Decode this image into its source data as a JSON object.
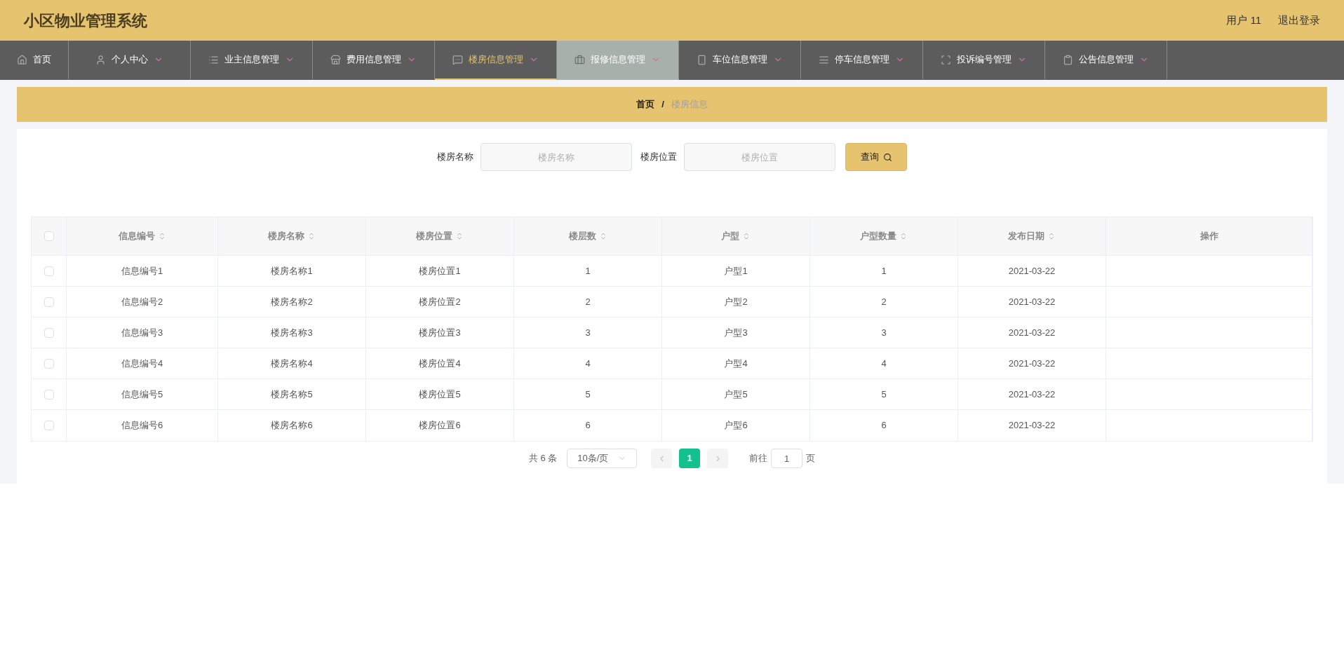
{
  "header": {
    "title": "小区物业管理系统",
    "user": "用户 11",
    "logout": "退出登录"
  },
  "nav": [
    {
      "label": "首页",
      "kind": "link",
      "selected": false,
      "hovered": false
    },
    {
      "label": "个人中心",
      "kind": "menu",
      "selected": false,
      "hovered": false
    },
    {
      "label": "业主信息管理",
      "kind": "menu",
      "selected": false,
      "hovered": false
    },
    {
      "label": "费用信息管理",
      "kind": "menu",
      "selected": false,
      "hovered": false
    },
    {
      "label": "楼房信息管理",
      "kind": "menu",
      "selected": true,
      "hovered": false
    },
    {
      "label": "报修信息管理",
      "kind": "menu",
      "selected": false,
      "hovered": true
    },
    {
      "label": "车位信息管理",
      "kind": "menu",
      "selected": false,
      "hovered": false
    },
    {
      "label": "停车信息管理",
      "kind": "menu",
      "selected": false,
      "hovered": false
    },
    {
      "label": "投诉编号管理",
      "kind": "menu",
      "selected": false,
      "hovered": false
    },
    {
      "label": "公告信息管理",
      "kind": "menu",
      "selected": false,
      "hovered": false
    }
  ],
  "breadcrumb": {
    "home": "首页",
    "separator": "/",
    "current": "楼房信息"
  },
  "search": {
    "fields": [
      {
        "label": "楼房名称",
        "placeholder": "楼房名称"
      },
      {
        "label": "楼房位置",
        "placeholder": "楼房位置"
      }
    ],
    "button": "查询"
  },
  "table": {
    "columns": [
      {
        "label": "信息编号",
        "kind": "sortable"
      },
      {
        "label": "楼房名称",
        "kind": "sortable"
      },
      {
        "label": "楼房位置",
        "kind": "sortable"
      },
      {
        "label": "楼层数",
        "kind": "sortable"
      },
      {
        "label": "户型",
        "kind": "sortable"
      },
      {
        "label": "户型数量",
        "kind": "sortable"
      },
      {
        "label": "发布日期",
        "kind": "sortable"
      },
      {
        "label": "操作",
        "kind": "plain"
      }
    ],
    "all_checked": false,
    "rows": [
      {
        "checked": false,
        "cells": [
          "信息编号1",
          "楼房名称1",
          "楼房位置1",
          "1",
          "户型1",
          "1",
          "2021-03-22",
          ""
        ]
      },
      {
        "checked": false,
        "cells": [
          "信息编号2",
          "楼房名称2",
          "楼房位置2",
          "2",
          "户型2",
          "2",
          "2021-03-22",
          ""
        ]
      },
      {
        "checked": false,
        "cells": [
          "信息编号3",
          "楼房名称3",
          "楼房位置3",
          "3",
          "户型3",
          "3",
          "2021-03-22",
          ""
        ]
      },
      {
        "checked": false,
        "cells": [
          "信息编号4",
          "楼房名称4",
          "楼房位置4",
          "4",
          "户型4",
          "4",
          "2021-03-22",
          ""
        ]
      },
      {
        "checked": false,
        "cells": [
          "信息编号5",
          "楼房名称5",
          "楼房位置5",
          "5",
          "户型5",
          "5",
          "2021-03-22",
          ""
        ]
      },
      {
        "checked": false,
        "cells": [
          "信息编号6",
          "楼房名称6",
          "楼房位置6",
          "6",
          "户型6",
          "6",
          "2021-03-22",
          ""
        ]
      }
    ]
  },
  "pagination": {
    "total": "共 6 条",
    "page_size": "10条/页",
    "pages": [
      {
        "label": "1",
        "selected": true
      }
    ],
    "goto_label": "前往",
    "goto_value": "1",
    "goto_suffix": "页"
  }
}
